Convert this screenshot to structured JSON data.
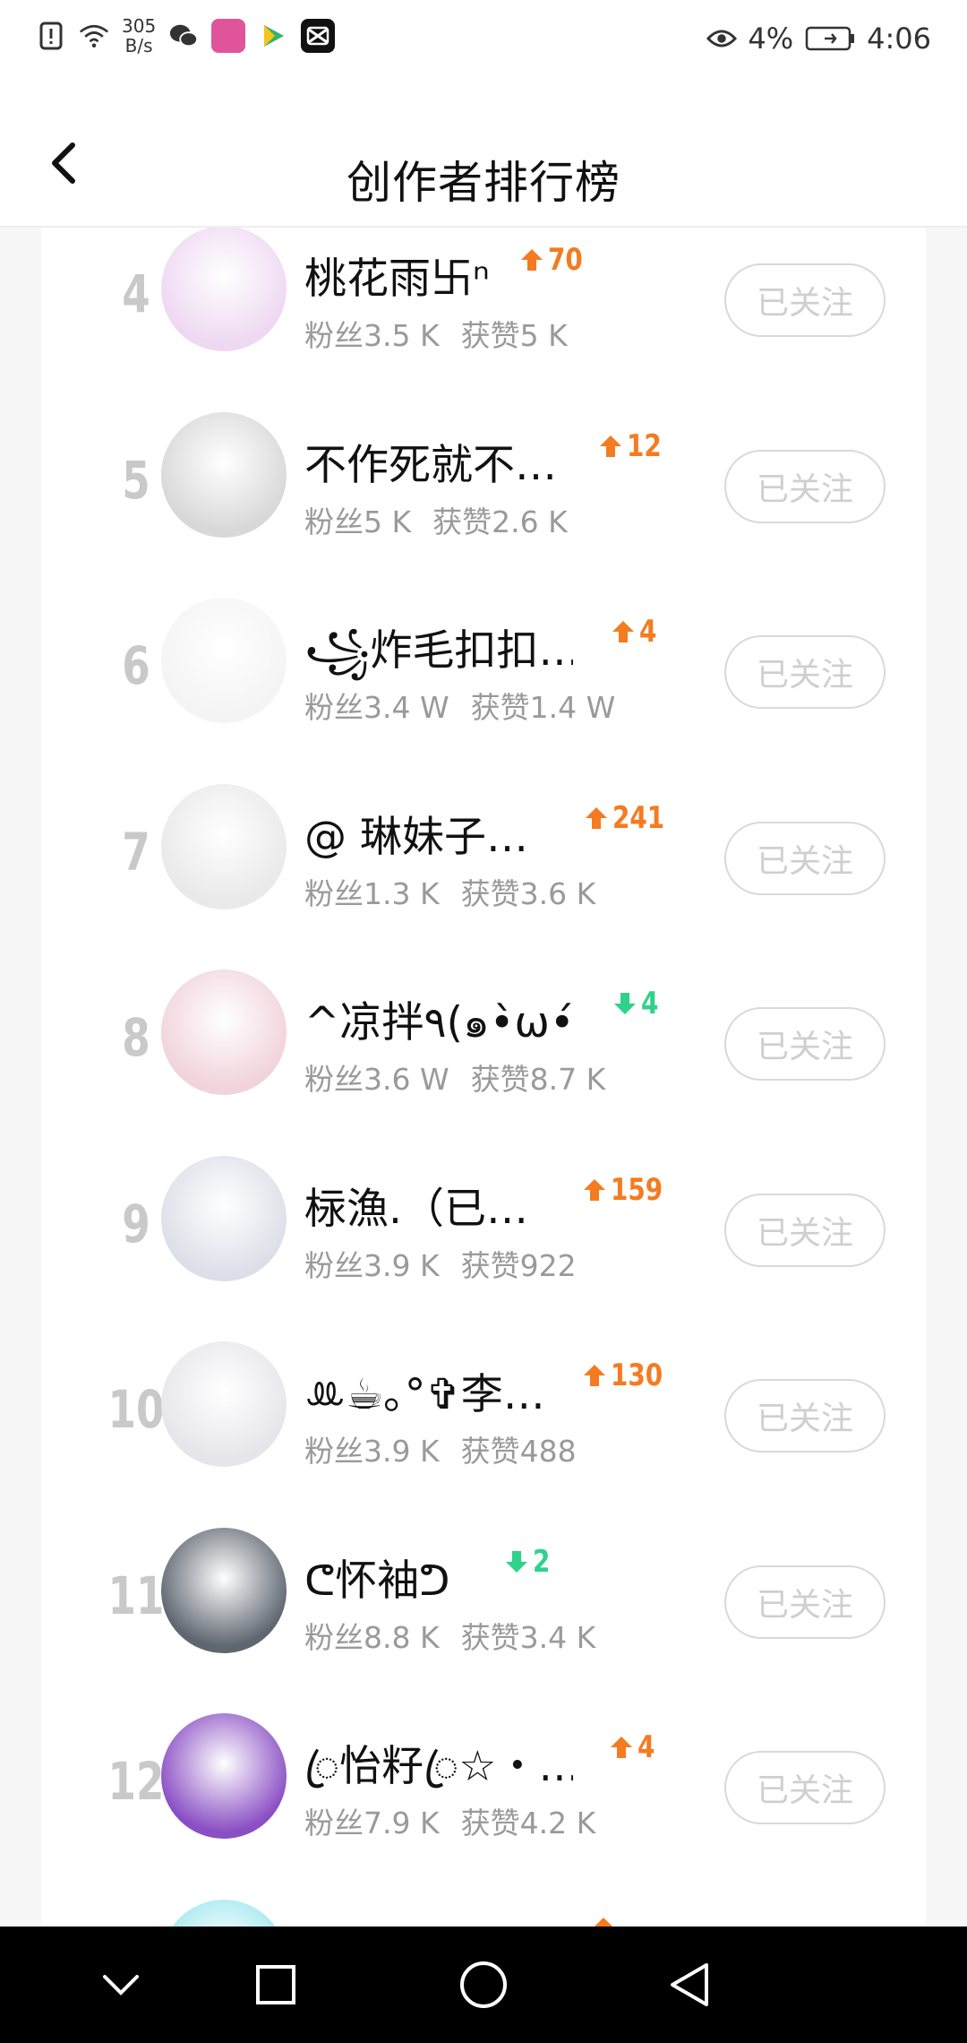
{
  "status_bar": {
    "net_speed_value": "305",
    "net_speed_unit": "B/s",
    "battery": "4%",
    "time": "4:06",
    "icons": [
      "alert-icon",
      "wifi-icon",
      "wechat-icon",
      "app-icon",
      "play-icon",
      "capcut-icon",
      "eye-icon",
      "battery-icon"
    ]
  },
  "header": {
    "title": "创作者排行榜",
    "back_icon": "chevron-left-icon"
  },
  "rows": [
    {
      "rank": "4",
      "name": "桃花雨卐ⁿ",
      "trend_dir": "up",
      "trend_value": "70",
      "fans": "粉丝3.5 K",
      "likes": "获赞5 K",
      "follow": "已关注",
      "avatar_color": "#eed8f2"
    },
    {
      "rank": "5",
      "name": "不作死就不…",
      "trend_dir": "up",
      "trend_value": "12",
      "fans": "粉丝5 K",
      "likes": "获赞2.6 K",
      "follow": "已关注",
      "avatar_color": "#d8d8d8"
    },
    {
      "rank": "6",
      "name": "꧁炸毛扣扣…",
      "trend_dir": "up",
      "trend_value": "4",
      "fans": "粉丝3.4 W",
      "likes": "获赞1.4 W",
      "follow": "已关注",
      "avatar_color": "#f4f4f4"
    },
    {
      "rank": "7",
      "name": "@ 琳妹子…",
      "trend_dir": "up",
      "trend_value": "241",
      "fans": "粉丝1.3 K",
      "likes": "获赞3.6 K",
      "follow": "已关注",
      "avatar_color": "#e9e9e9"
    },
    {
      "rank": "8",
      "name": "^凉拌٩(๑•̀ω•́๑)۶…",
      "trend_dir": "down",
      "trend_value": "4",
      "fans": "粉丝3.6 W",
      "likes": "获赞8.7 K",
      "follow": "已关注",
      "avatar_color": "#f1d3dc"
    },
    {
      "rank": "9",
      "name": "柡漁.（已…",
      "trend_dir": "up",
      "trend_value": "159",
      "fans": "粉丝3.9 K",
      "likes": "获赞922",
      "follow": "已关注",
      "avatar_color": "#dcdfe8"
    },
    {
      "rank": "10",
      "name": "ꔛ☕｡°✞李…",
      "trend_dir": "up",
      "trend_value": "130",
      "fans": "粉丝3.9 K",
      "likes": "获赞488",
      "follow": "已关注",
      "avatar_color": "#e6e6ea"
    },
    {
      "rank": "11",
      "name": "ᕦ怀袖ᕤ",
      "trend_dir": "down",
      "trend_value": "2",
      "fans": "粉丝8.8 K",
      "likes": "获赞3.4 K",
      "follow": "已关注",
      "avatar_color": "#5e6670"
    },
    {
      "rank": "12",
      "name": "ꦿ怡籽ꦿ☆・…",
      "trend_dir": "up",
      "trend_value": "4",
      "fans": "粉丝7.9 K",
      "likes": "获赞4.2 K",
      "follow": "已关注",
      "avatar_color": "#8a4fc4"
    },
    {
      "rank": "",
      "name": "",
      "trend_dir": "up",
      "trend_value": "",
      "fans": "",
      "likes": "",
      "follow": "",
      "avatar_color": "#9be7ef"
    }
  ],
  "nav": {
    "icons": [
      "nav-collapse-icon",
      "nav-recents-icon",
      "nav-home-icon",
      "nav-back-icon"
    ]
  }
}
